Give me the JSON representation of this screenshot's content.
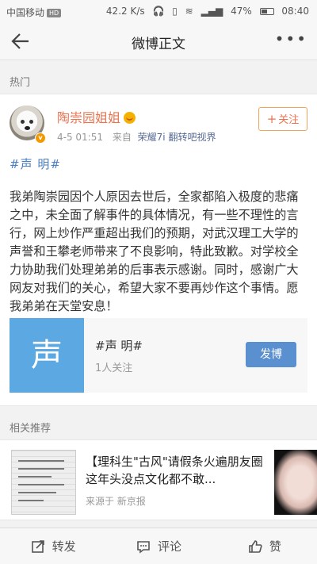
{
  "status_bar": {
    "carrier": "中国移动",
    "network_badge": "HD",
    "speed": "42.2 K/s",
    "battery": "47%",
    "time": "08:40"
  },
  "nav": {
    "title": "微博正文"
  },
  "sections": {
    "hot": "热门",
    "related": "相关推荐"
  },
  "post": {
    "username": "陶崇园姐姐",
    "time": "4-5 01:51",
    "from_label": "来自",
    "source": "荣耀7i 翻转吧视界",
    "follow_label": "关注",
    "hashtag": "#声  明#",
    "text": "我弟陶崇园因个人原因去世后，全家都陷入极度的悲痛之中，未全面了解事件的具体情况，有一些不理性的言行，网上炒作严重超出我们的预期，对武汉理工大学的声誉和王攀老师带来了不良影响，特此致歉。对学校全力协助我们处理弟弟的后事表示感谢。同时，感谢广大网友对我们的关心，希望大家不要再炒作这个事情。愿我弟弟在天堂安息！",
    "topic": {
      "thumb_char": "声",
      "title": "#声  明#",
      "followers": "1人关注",
      "button": "发博"
    }
  },
  "related": {
    "title": "【理科生\"古风\"请假条火遍朋友圈 这年头没点文化都不敢...",
    "source": "来源于 新京报"
  },
  "toolbar": {
    "repost": "转发",
    "comment": "评论",
    "like": "赞"
  }
}
